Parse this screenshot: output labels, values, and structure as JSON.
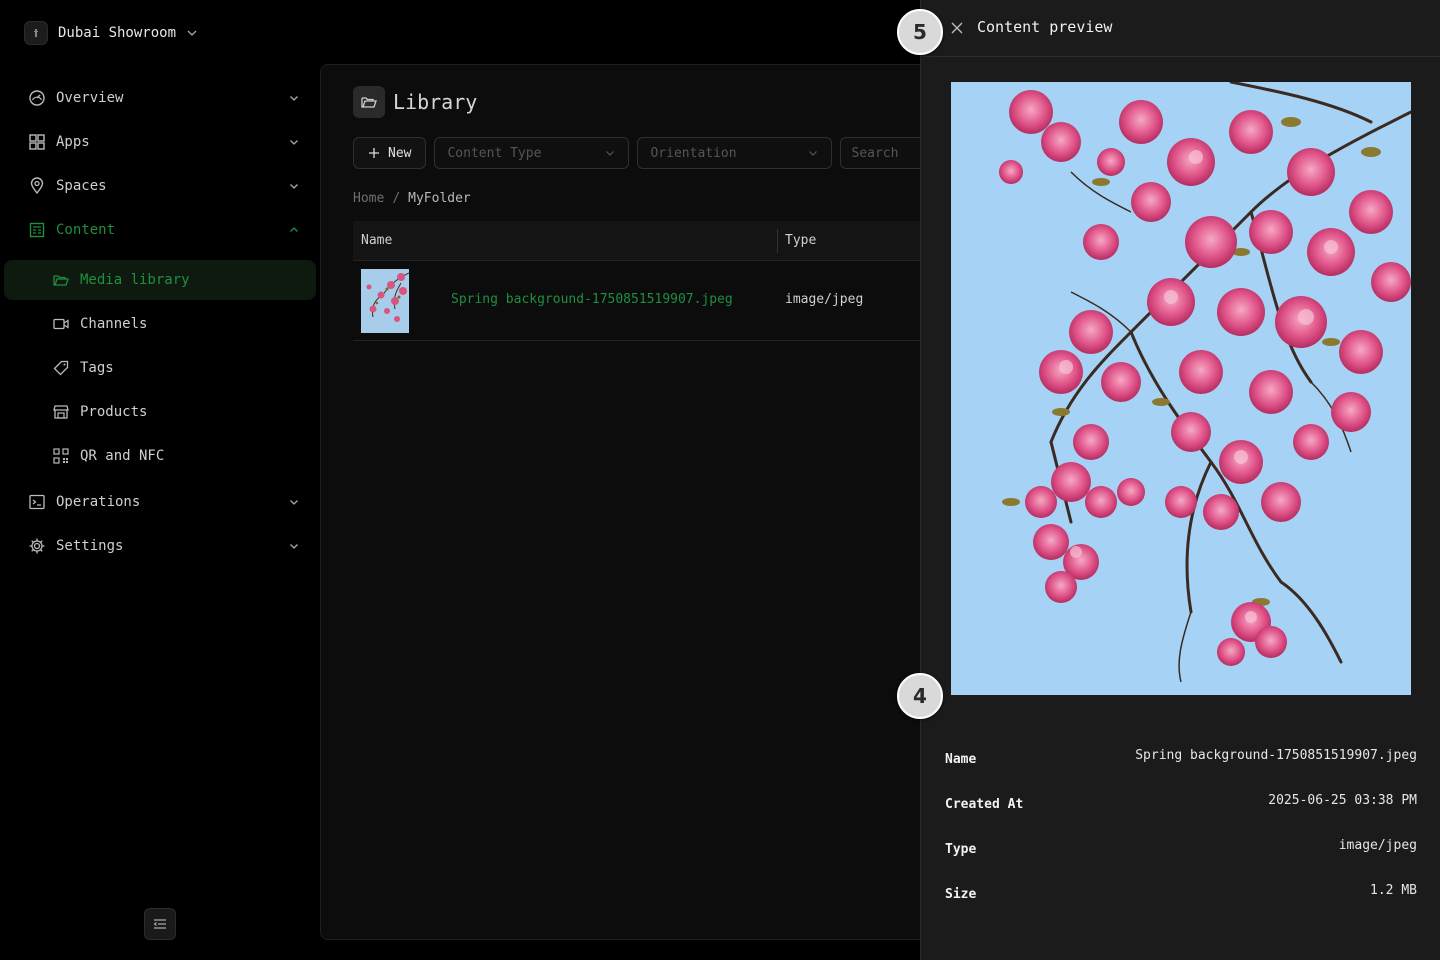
{
  "workspace": {
    "name": "Dubai Showroom"
  },
  "nav": {
    "overview": "Overview",
    "apps": "Apps",
    "spaces": "Spaces",
    "content": "Content",
    "media_library": "Media library",
    "channels": "Channels",
    "tags": "Tags",
    "products": "Products",
    "qr_nfc": "QR and NFC",
    "operations": "Operations",
    "settings": "Settings"
  },
  "library": {
    "title": "Library",
    "new_label": "New",
    "content_type_placeholder": "Content Type",
    "orientation_placeholder": "Orientation",
    "search_placeholder": "Search"
  },
  "breadcrumb": {
    "home": "Home",
    "separator": "/",
    "current": "MyFolder"
  },
  "table": {
    "columns": [
      "Name",
      "Type"
    ],
    "rows": [
      {
        "name": "Spring background-1750851519907.jpeg",
        "type": "image/jpeg"
      }
    ]
  },
  "preview": {
    "title": "Content preview",
    "details": [
      {
        "label": "Name",
        "value": "Spring background-1750851519907.jpeg"
      },
      {
        "label": "Created At",
        "value": "2025-06-25 03:38 PM"
      },
      {
        "label": "Type",
        "value": "image/jpeg"
      },
      {
        "label": "Size",
        "value": "1.2 MB"
      }
    ]
  },
  "badges": {
    "close_step": "5",
    "image_step": "4"
  },
  "colors": {
    "accent": "#1f8f3e",
    "drawer_bg": "#1b1b1b",
    "sky": "#a6d2f5",
    "blossom": "#e25c8e"
  }
}
